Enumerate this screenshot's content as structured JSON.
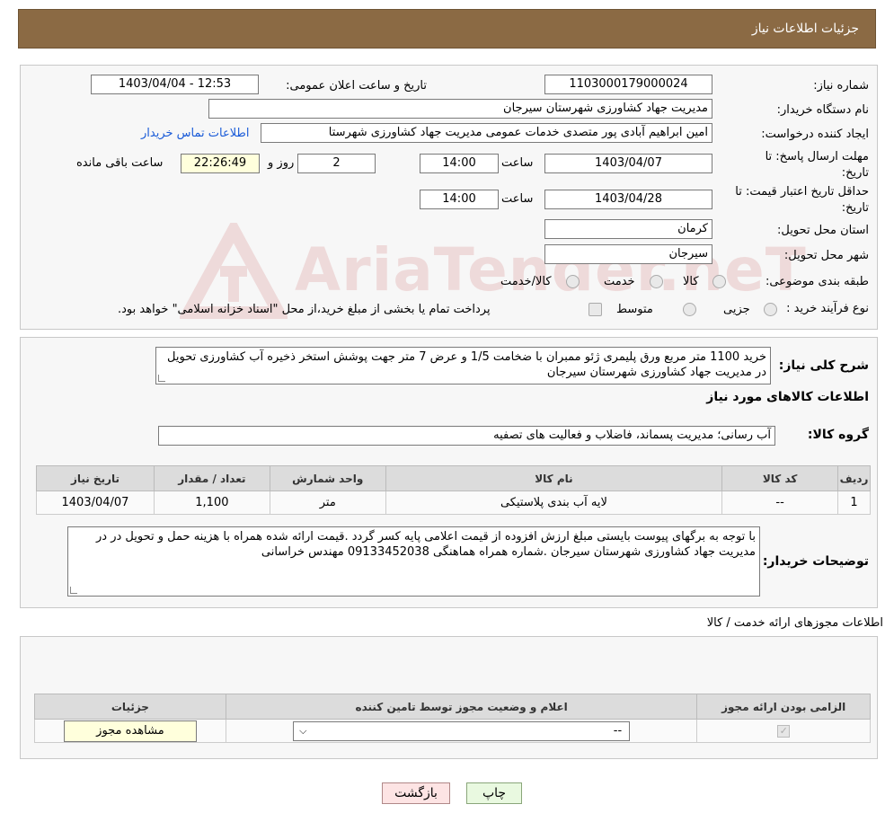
{
  "header": {
    "title": "جزئیات اطلاعات نیاز"
  },
  "fields": {
    "need_number_label": "شماره نیاز:",
    "need_number": "1103000179000024",
    "announce_label": "تاریخ و ساعت اعلان عمومی:",
    "announce_value": "1403/04/04 - 12:53",
    "buyer_org_label": "نام دستگاه خریدار:",
    "buyer_org": "مدیریت جهاد کشاورزی شهرستان سیرجان",
    "requester_label": "ایجاد کننده درخواست:",
    "requester": "امین ابراهیم آبادی پور متصدی خدمات عمومی مدیریت جهاد کشاورزی شهرستا",
    "contact_link": "اطلاعات تماس خریدار",
    "deadline_label_1": "مهلت ارسال پاسخ: تا",
    "deadline_label_2": "تاریخ:",
    "deadline_date": "1403/04/07",
    "time_label": "ساعت",
    "deadline_time": "14:00",
    "days_value": "2",
    "days_label": "روز و",
    "remaining_time": "22:26:49",
    "remaining_label": "ساعت باقی مانده",
    "validity_label_1": "حداقل تاریخ اعتبار قیمت: تا",
    "validity_label_2": "تاریخ:",
    "validity_date": "1403/04/28",
    "validity_time": "14:00",
    "province_label": "استان محل تحویل:",
    "province": "کرمان",
    "city_label": "شهر محل تحویل:",
    "city": "سیرجان",
    "category_label": "طبقه بندی موضوعی:",
    "category_options": [
      "کالا",
      "خدمت",
      "کالا/خدمت"
    ],
    "process_label": "نوع فرآیند خرید :",
    "process_options": [
      "جزیی",
      "متوسط"
    ],
    "process_note": "پرداخت تمام یا بخشی از مبلغ خرید،از محل \"اسناد خزانه اسلامی\" خواهد بود."
  },
  "description": {
    "label": "شرح کلی نیاز:",
    "text": "خرید 1100 متر مربع  ورق پلیمری ژئو ممبران با ضخامت 1/5 و عرض 7 متر جهت پوشش استخر ذخیره آب کشاورزی تحویل در مدیریت جهاد کشاورزی شهرستان سیرجان"
  },
  "goods": {
    "section_title": "اطلاعات کالاهای مورد نیاز",
    "group_label": "گروه کالا:",
    "group_value": "آب رسانی؛ مدیریت پسماند، فاضلاب و فعالیت های تصفیه",
    "columns": [
      "ردیف",
      "کد کالا",
      "نام کالا",
      "واحد شمارش",
      "تعداد / مقدار",
      "تاریخ نیاز"
    ],
    "rows": [
      [
        "1",
        "--",
        "لایه آب بندی پلاستیکی",
        "متر",
        "1,100",
        "1403/04/07"
      ]
    ]
  },
  "buyer_notes": {
    "label": "توضیحات خریدار:",
    "text": "با توجه به برگهای پیوست بایستی مبلغ ارزش افزوده از قیمت اعلامی پایه کسر گردد .قیمت ارائه شده همراه با هزینه حمل و تحویل در در مدیریت جهاد کشاورزی شهرستان سیرجان .شماره همراه  هماهنگی 09133452038 مهندس خراسانی"
  },
  "permits": {
    "section_title": "اطلاعات مجوزهای ارائه خدمت / کالا",
    "columns": [
      "الزامی بودن ارائه مجوز",
      "اعلام و وضعیت مجوز توسط تامین کننده",
      "جزئیات"
    ],
    "select_value": "--",
    "view_button": "مشاهده مجوز"
  },
  "buttons": {
    "print": "چاپ",
    "back": "بازگشت"
  },
  "watermark": {
    "text": "AriaTender.neT"
  },
  "colors": {
    "header_bg": "#8b6a44",
    "print_btn_bg": "#e9f9e0",
    "back_btn_bg": "#fde4e4",
    "yellow_box": "#ffffdc"
  }
}
